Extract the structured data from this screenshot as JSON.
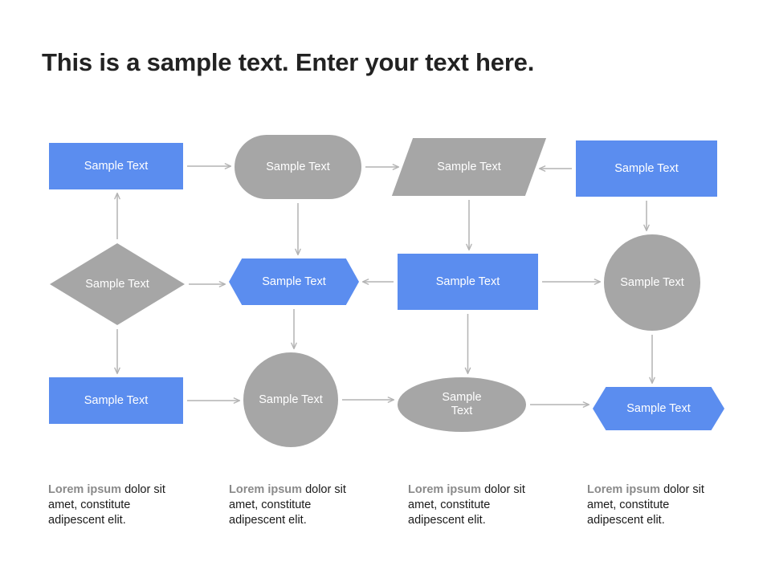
{
  "slide": {
    "title": "This is a sample text. Enter your text here.",
    "background": "#ffffff"
  },
  "colors": {
    "blue": "#5b8def",
    "gray": "#a6a6a6",
    "arrow": "#b3b3b3",
    "title_text": "#222222",
    "shape_text": "#ffffff",
    "caption_lead": "#8a8a8a",
    "caption_body": "#1a1a1a"
  },
  "flowchart": {
    "rows": 3,
    "columns": 4,
    "nodes": [
      {
        "id": "r1c1",
        "row": 1,
        "col": 1,
        "shape": "rectangle",
        "fill": "blue",
        "label": "Sample Text"
      },
      {
        "id": "r1c2",
        "row": 1,
        "col": 2,
        "shape": "stadium",
        "fill": "gray",
        "label": "Sample Text"
      },
      {
        "id": "r1c3",
        "row": 1,
        "col": 3,
        "shape": "parallelogram",
        "fill": "gray",
        "label": "Sample Text"
      },
      {
        "id": "r1c4",
        "row": 1,
        "col": 4,
        "shape": "rectangle",
        "fill": "blue",
        "label": "Sample Text"
      },
      {
        "id": "r2c1",
        "row": 2,
        "col": 1,
        "shape": "diamond",
        "fill": "gray",
        "label": "Sample Text"
      },
      {
        "id": "r2c2",
        "row": 2,
        "col": 2,
        "shape": "hexagon",
        "fill": "blue",
        "label": "Sample Text"
      },
      {
        "id": "r2c3",
        "row": 2,
        "col": 3,
        "shape": "rectangle",
        "fill": "blue",
        "label": "Sample Text"
      },
      {
        "id": "r2c4",
        "row": 2,
        "col": 4,
        "shape": "circle",
        "fill": "gray",
        "label": "Sample Text"
      },
      {
        "id": "r3c1",
        "row": 3,
        "col": 1,
        "shape": "rectangle",
        "fill": "blue",
        "label": "Sample Text"
      },
      {
        "id": "r3c2",
        "row": 3,
        "col": 2,
        "shape": "circle",
        "fill": "gray",
        "label": "Sample Text"
      },
      {
        "id": "r3c3",
        "row": 3,
        "col": 3,
        "shape": "ellipse",
        "fill": "gray",
        "label": "Sample\nText"
      },
      {
        "id": "r3c4",
        "row": 3,
        "col": 4,
        "shape": "hexagon",
        "fill": "blue",
        "label": "Sample Text"
      }
    ],
    "connectors": [
      {
        "id": "c1",
        "from": "r1c1",
        "to": "r1c2",
        "direction": "right"
      },
      {
        "id": "c2",
        "from": "r1c2",
        "to": "r1c3",
        "direction": "right"
      },
      {
        "id": "c3",
        "from": "r1c4",
        "to": "r1c3",
        "direction": "left"
      },
      {
        "id": "c4",
        "from": "r1c2",
        "to": "r2c2",
        "direction": "down"
      },
      {
        "id": "c5",
        "from": "r1c3",
        "to": "r2c3",
        "direction": "down"
      },
      {
        "id": "c6",
        "from": "r1c4",
        "to": "r2c4",
        "direction": "down"
      },
      {
        "id": "c7",
        "from": "r2c1",
        "to": "r1c1",
        "direction": "up"
      },
      {
        "id": "c8",
        "from": "r2c1",
        "to": "r2c2",
        "direction": "right"
      },
      {
        "id": "c9",
        "from": "r2c3",
        "to": "r2c2",
        "direction": "left"
      },
      {
        "id": "c10",
        "from": "r2c3",
        "to": "r2c4",
        "direction": "right"
      },
      {
        "id": "c11",
        "from": "r2c1",
        "to": "r3c1",
        "direction": "down"
      },
      {
        "id": "c12",
        "from": "r2c2",
        "to": "r3c2",
        "direction": "down"
      },
      {
        "id": "c13",
        "from": "r2c3",
        "to": "r3c3",
        "direction": "down"
      },
      {
        "id": "c14",
        "from": "r2c4",
        "to": "r3c4",
        "direction": "down"
      },
      {
        "id": "c15",
        "from": "r3c1",
        "to": "r3c2",
        "direction": "right"
      },
      {
        "id": "c16",
        "from": "r3c2",
        "to": "r3c3",
        "direction": "right"
      },
      {
        "id": "c17",
        "from": "r3c3",
        "to": "r3c4",
        "direction": "right"
      }
    ]
  },
  "captions": [
    {
      "id": "cap1",
      "lead": "Lorem ipsum",
      "body": " dolor sit amet, constitute adipescent elit."
    },
    {
      "id": "cap2",
      "lead": "Lorem ipsum",
      "body": " dolor sit amet, constitute adipescent elit."
    },
    {
      "id": "cap3",
      "lead": "Lorem ipsum",
      "body": " dolor sit amet, constitute adipescent elit."
    },
    {
      "id": "cap4",
      "lead": "Lorem ipsum",
      "body": " dolor sit amet, constitute adipescent elit."
    }
  ]
}
